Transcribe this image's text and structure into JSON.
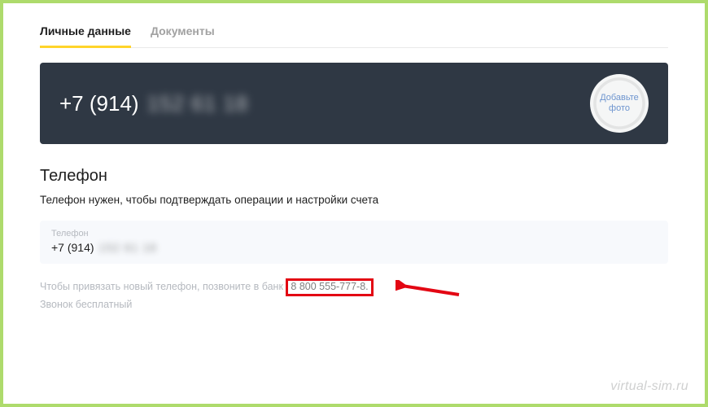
{
  "tabs": {
    "personal": "Личные данные",
    "documents": "Документы"
  },
  "hero": {
    "phone_prefix": "+7 (914)",
    "phone_rest": "152 61 18"
  },
  "avatar": {
    "line1": "Добавьте",
    "line2": "фото"
  },
  "section": {
    "title": "Телефон",
    "desc": "Телефон нужен, чтобы подтверждать операции и настройки счета"
  },
  "field": {
    "label": "Телефон",
    "value_prefix": "+7 (914)",
    "value_rest": "152 61 18"
  },
  "help": {
    "line1_a": "Чтобы привязать новый телефон, позвоните в банк ",
    "number": "8 800 555-777-8.",
    "line2": "Звонок бесплатный"
  },
  "watermark": "virtual-sim.ru"
}
